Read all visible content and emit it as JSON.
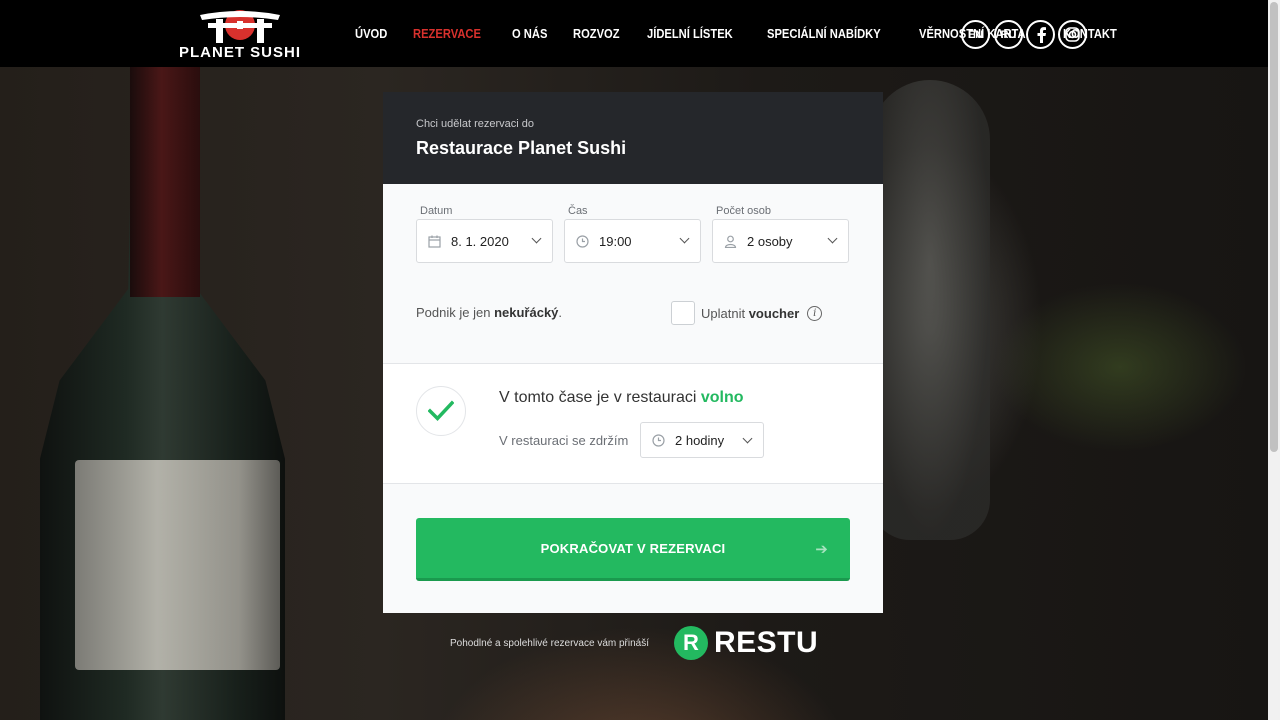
{
  "header": {
    "logo_text": "PLANET SUSHI",
    "nav": [
      {
        "label": "ÚVOD",
        "active": false
      },
      {
        "label": "REZERVACE",
        "active": true
      },
      {
        "label": "O NÁS",
        "active": false
      },
      {
        "label": "ROZVOZ",
        "active": false
      },
      {
        "label": "JÍDELNÍ LÍSTEK",
        "active": false
      },
      {
        "label": "SPECIÁLNÍ NABÍDKY",
        "active": false
      },
      {
        "label": "VĚRNOSTNÍ KARTA",
        "active": false
      },
      {
        "label": "KONTAKT",
        "active": false
      }
    ],
    "lang_en": "EN",
    "lang_ru": "RU"
  },
  "card": {
    "subtitle": "Chci udělat rezervaci do",
    "title": "Restaurace Planet Sushi",
    "date": {
      "label": "Datum",
      "value": "8. 1. 2020"
    },
    "time": {
      "label": "Čas",
      "value": "19:00"
    },
    "people": {
      "label": "Počet osob",
      "value": "2 osoby"
    },
    "note_prefix": "Podnik je jen",
    "note_bold": "nekuřácký",
    "note_suffix": ".",
    "voucher_prefix": "Uplatnit",
    "voucher_bold": "voucher",
    "availability_prefix": "V tomto čase je v restauraci",
    "availability_status": "volno",
    "stay_label": "V restauraci se zdržím",
    "stay_value": "2 hodiny",
    "continue_label": "POKRAČOVAT V REZERVACI"
  },
  "footer": {
    "powered_by": "Pohodlné a spolehlivé rezervace vám přináší",
    "brand": "RESTU"
  },
  "colors": {
    "accent_green": "#23b960",
    "active_nav_red": "#d8312d",
    "card_header": "#25272b"
  },
  "icons": [
    "calendar-icon",
    "clock-icon",
    "person-icon",
    "chevron-down-icon",
    "info-icon",
    "check-icon",
    "arrow-right-icon",
    "facebook-icon",
    "instagram-icon"
  ]
}
